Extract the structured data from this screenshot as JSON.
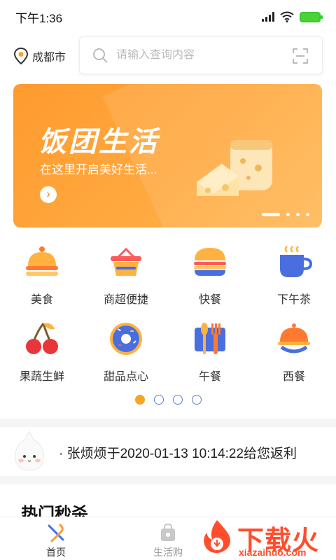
{
  "status_bar": {
    "time": "下午1:36"
  },
  "header": {
    "location": "成都市",
    "search_placeholder": "请输入查询内容"
  },
  "banner": {
    "title": "饭团生活",
    "subtitle": "在这里开启美好生活...",
    "slide_count": 4,
    "active_slide": 1
  },
  "categories": [
    {
      "label": "美食",
      "icon": "food-cloche-icon"
    },
    {
      "label": "商超便捷",
      "icon": "shopping-basket-icon"
    },
    {
      "label": "快餐",
      "icon": "burger-icon"
    },
    {
      "label": "下午茶",
      "icon": "coffee-cup-icon"
    },
    {
      "label": "果蔬生鲜",
      "icon": "cherry-icon"
    },
    {
      "label": "甜品点心",
      "icon": "donut-icon"
    },
    {
      "label": "午餐",
      "icon": "cutlery-icon"
    },
    {
      "label": "西餐",
      "icon": "serving-dish-icon"
    }
  ],
  "category_pages": {
    "count": 4,
    "active": 1
  },
  "notice": {
    "text": "· 张烦烦于2020-01-13 10:14:22给您返利"
  },
  "section": {
    "title": "热门秒杀"
  },
  "tabbar": {
    "tabs": [
      {
        "label": "首页",
        "icon": "home-cutlery-icon",
        "active": true
      },
      {
        "label": "生活购",
        "icon": "shopping-bag-icon",
        "active": false
      }
    ]
  },
  "watermark": {
    "text": "下载火",
    "url": "xiazaihuo.com"
  },
  "colors": {
    "accent": "#ff9a2f",
    "dot_blue": "#5b7bd5",
    "watermark": "#ff4d2d"
  }
}
